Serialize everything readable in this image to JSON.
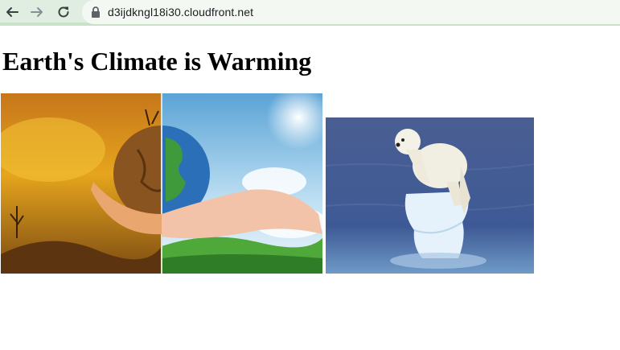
{
  "browser": {
    "url": "d3ijdkngl18i30.cloudfront.net",
    "back_icon": "arrow-left-icon",
    "forward_icon": "arrow-right-icon",
    "reload_icon": "reload-icon",
    "lock_icon": "lock-icon"
  },
  "page": {
    "heading": "Earth's Climate is Warming",
    "images": [
      {
        "subject": "hands-holding-earth-split-scorched-and-green"
      },
      {
        "subject": "polar-bear-on-melting-ice"
      }
    ]
  },
  "colors": {
    "toolbar_bg": "#dfeee0",
    "toolbar_accent": "#c7e2c7",
    "url_bg": "#f3f8f3"
  }
}
